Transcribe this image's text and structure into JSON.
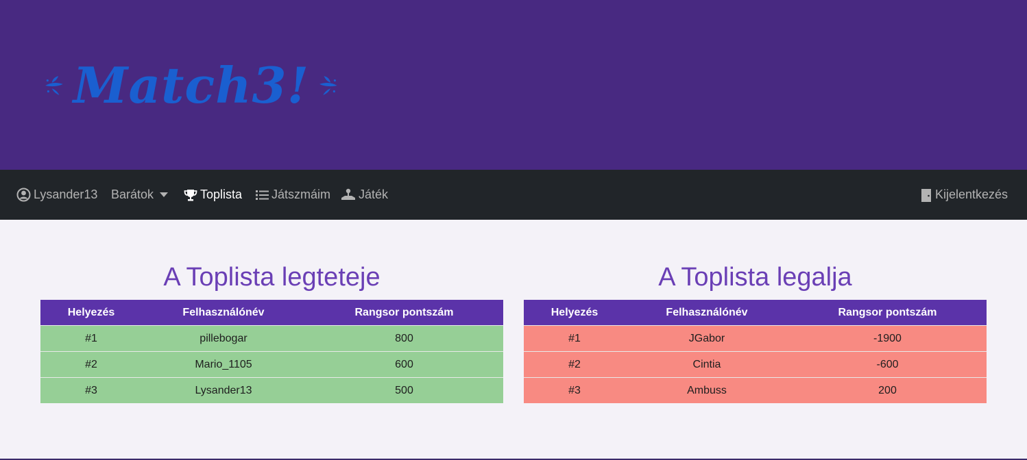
{
  "app": {
    "logo_text": "Match3!"
  },
  "colors": {
    "header_bg": "#482981",
    "navbar_bg": "#212529",
    "accent": "#5b33a9",
    "top_rows": "#96cf96",
    "bottom_rows": "#f88a82"
  },
  "nav": {
    "user": "Lysander13",
    "friends": "Barátok",
    "leaderboard": "Toplista",
    "my_games": "Játszmáim",
    "play": "Játék",
    "logout": "Kijelentkezés"
  },
  "top_board": {
    "title": "A Toplista legteteje",
    "headers": [
      "Helyezés",
      "Felhasználónév",
      "Rangsor pontszám"
    ],
    "rows": [
      [
        "#1",
        "pillebogar",
        "800"
      ],
      [
        "#2",
        "Mario_1105",
        "600"
      ],
      [
        "#3",
        "Lysander13",
        "500"
      ]
    ]
  },
  "bottom_board": {
    "title": "A Toplista legalja",
    "headers": [
      "Helyezés",
      "Felhasználónév",
      "Rangsor pontszám"
    ],
    "rows": [
      [
        "#1",
        "JGabor",
        "-1900"
      ],
      [
        "#2",
        "Cintia",
        "-600"
      ],
      [
        "#3",
        "Ambuss",
        "200"
      ]
    ]
  }
}
